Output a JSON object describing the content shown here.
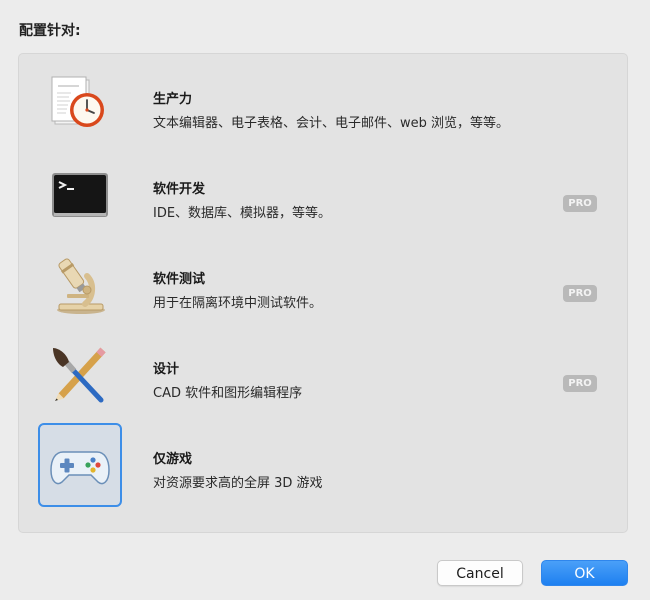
{
  "header": {
    "title": "配置针对:"
  },
  "options": [
    {
      "title": "生产力",
      "desc": "文本编辑器、电子表格、会计、电子邮件、web 浏览，等等。",
      "pro": false,
      "selected": false,
      "icon": "document-clock-icon"
    },
    {
      "title": "软件开发",
      "desc": "IDE、数据库、模拟器，等等。",
      "pro": true,
      "selected": false,
      "icon": "terminal-icon"
    },
    {
      "title": "软件测试",
      "desc": "用于在隔离环境中测试软件。",
      "pro": true,
      "selected": false,
      "icon": "microscope-icon"
    },
    {
      "title": "设计",
      "desc": "CAD 软件和图形编辑程序",
      "pro": true,
      "selected": false,
      "icon": "brush-pencil-icon"
    },
    {
      "title": "仅游戏",
      "desc": "对资源要求高的全屏 3D 游戏",
      "pro": false,
      "selected": true,
      "icon": "gamepad-icon"
    }
  ],
  "badge": {
    "pro_label": "PRO"
  },
  "buttons": {
    "cancel": "Cancel",
    "ok": "OK"
  },
  "colors": {
    "accent": "#3d8ee8",
    "ok_button": "#1e80f0",
    "pro_badge": "#b9b9b9"
  }
}
